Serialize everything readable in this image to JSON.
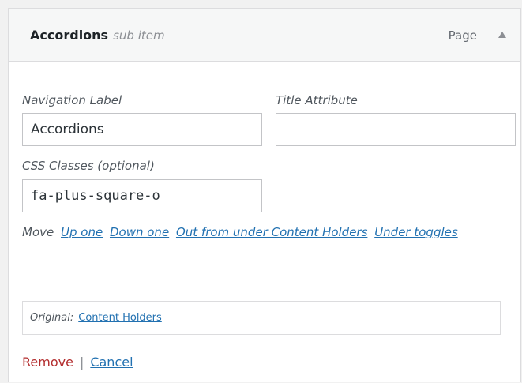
{
  "item": {
    "title": "Accordions",
    "subtitle": "sub item",
    "type": "Page"
  },
  "fields": {
    "navigation_label": {
      "label": "Navigation Label",
      "value": "Accordions"
    },
    "title_attribute": {
      "label": "Title Attribute",
      "value": ""
    },
    "css_classes": {
      "label": "CSS Classes (optional)",
      "value": "fa-plus-square-o"
    }
  },
  "move": {
    "label": "Move",
    "links": [
      "Up one",
      "Down one",
      "Out from under Content Holders",
      "Under toggles"
    ]
  },
  "original": {
    "label": "Original:",
    "link": "Content Holders"
  },
  "actions": {
    "remove": "Remove",
    "separator": "|",
    "cancel": "Cancel"
  },
  "icons": {
    "toggle": "arrow-up-icon"
  },
  "colors": {
    "link": "#2271b1",
    "remove": "#b32d2e",
    "header_bg": "#f6f7f7",
    "border": "#dcdcde"
  }
}
